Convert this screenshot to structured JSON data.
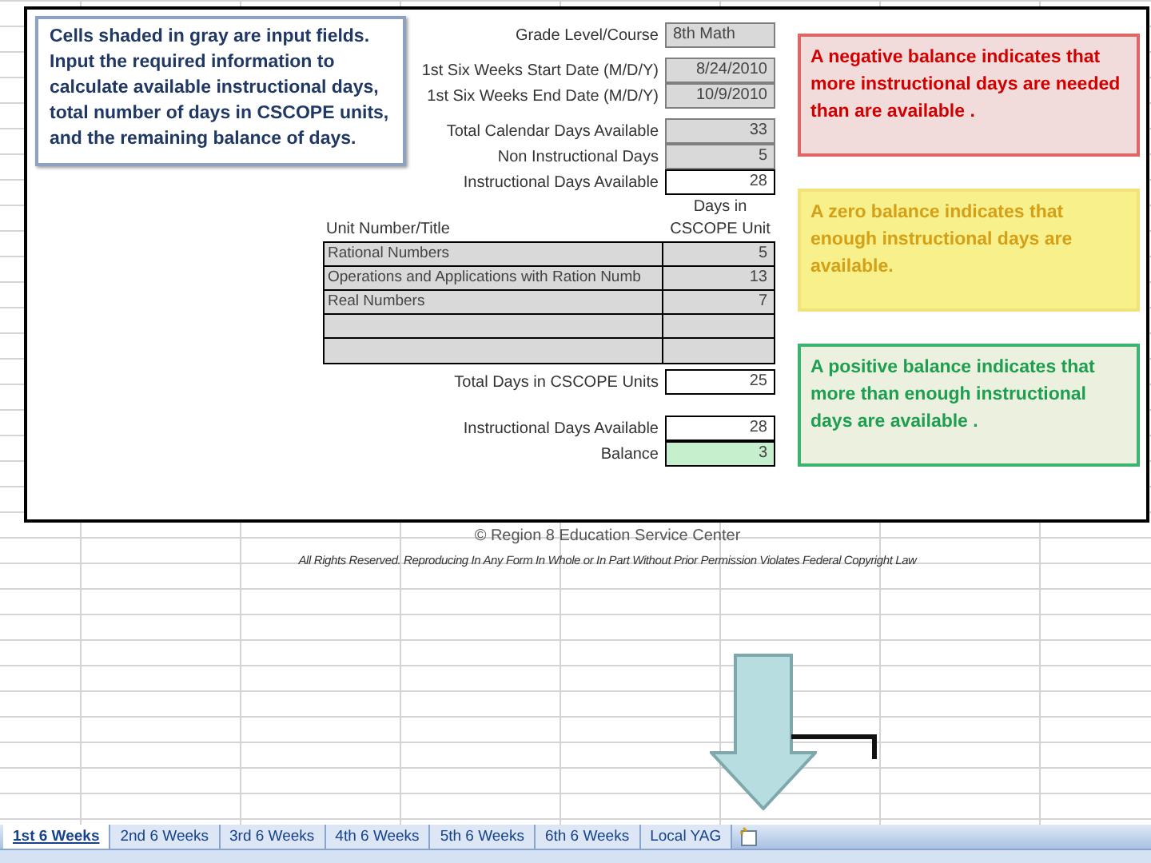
{
  "instructions": "Cells shaded in gray are input fields. Input the required information to calculate available instructional days, total number of days in CSCOPE units, and the remaining balance of days.",
  "form_groups": [
    [
      {
        "label": "Grade Level/Course",
        "value": "8th Math",
        "kind": "input_text"
      }
    ],
    [
      {
        "label": "1st  Six Weeks Start Date (M/D/Y)",
        "value": "8/24/2010",
        "kind": "input"
      },
      {
        "label": "1st Six Weeks End Date  (M/D/Y)",
        "value": "10/9/2010",
        "kind": "input"
      }
    ],
    [
      {
        "label": "Total Calendar Days Available",
        "value": "33",
        "kind": "input"
      },
      {
        "label": "Non Instructional Days",
        "value": "5",
        "kind": "input"
      },
      {
        "label": "Instructional Days Available",
        "value": "28",
        "kind": "calc"
      }
    ]
  ],
  "units": {
    "title_header": "Unit Number/Title",
    "days_header": "Days in CSCOPE Unit",
    "rows": [
      {
        "title": "Rational Numbers",
        "days": "5"
      },
      {
        "title": "Operations and Applications with Ration Numb",
        "days": "13"
      },
      {
        "title": "Real Numbers",
        "days": "7"
      }
    ]
  },
  "summary_groups": [
    [
      {
        "label": "Total Days in CSCOPE Units",
        "value": "25",
        "kind": "calc"
      }
    ],
    [
      {
        "label": "Instructional Days Available",
        "value": "28",
        "kind": "calc"
      },
      {
        "label": "Balance",
        "value": "3",
        "kind": "balance"
      }
    ]
  ],
  "notes": [
    {
      "kind": "negative",
      "text": "A negative balance indicates that more instructional days are needed than are available ."
    },
    {
      "kind": "zero",
      "text": "A zero balance indicates that enough  instructional days are available."
    },
    {
      "kind": "positive",
      "text": "A positive balance indicates that more than enough instructional days are available ."
    }
  ],
  "footer": {
    "copyright": "© Region 8 Education Service Center",
    "rights": "All Rights Reserved. Reproducing In Any Form In Whole or In Part Without Prior Permission Violates Federal Copyright Law"
  },
  "sheet_tabs": [
    {
      "label": "1st 6 Weeks",
      "selected": true
    },
    {
      "label": "2nd 6 Weeks",
      "selected": false
    },
    {
      "label": "3rd 6 Weeks",
      "selected": false
    },
    {
      "label": "4th 6 Weeks",
      "selected": false
    },
    {
      "label": "5th 6 Weeks",
      "selected": false
    },
    {
      "label": "6th 6 Weeks",
      "selected": false
    },
    {
      "label": "Local YAG",
      "selected": false
    }
  ]
}
